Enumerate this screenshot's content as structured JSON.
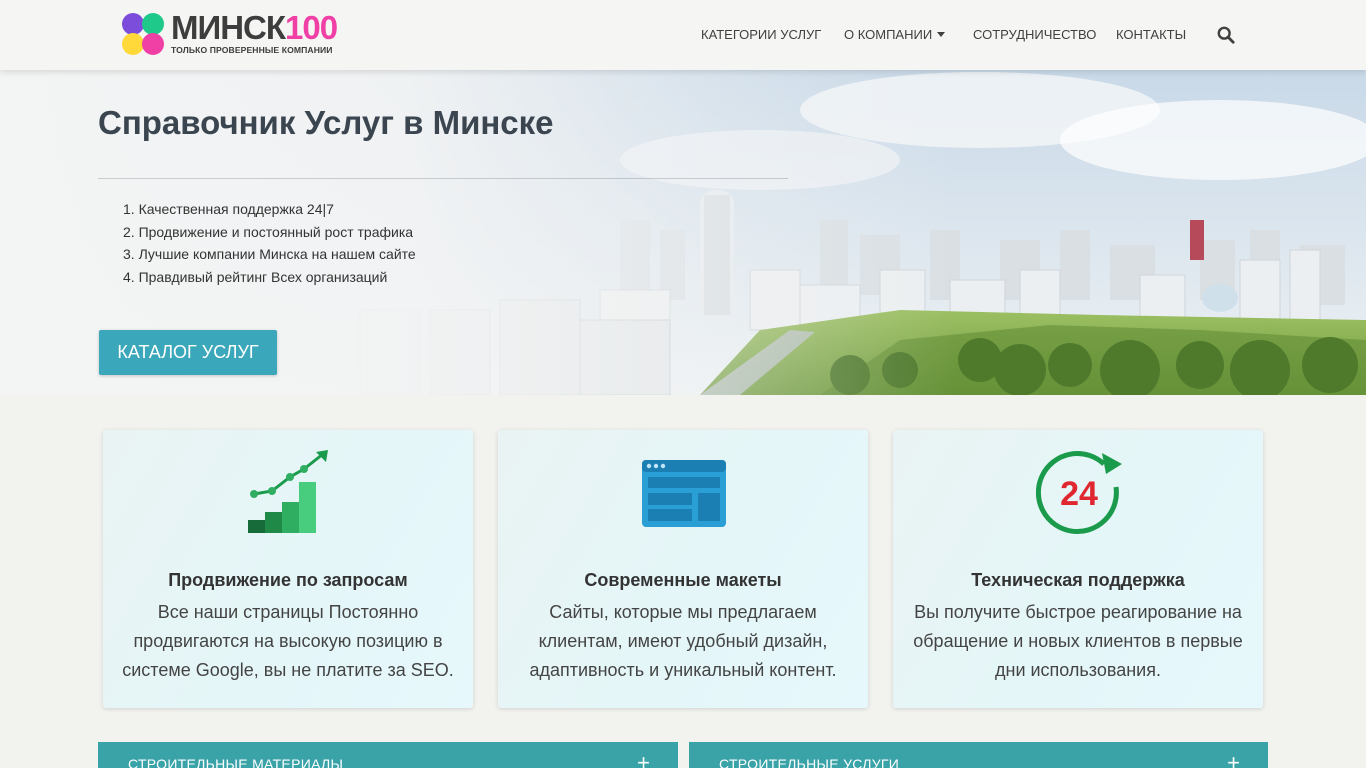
{
  "header": {
    "logo": {
      "name_text": "МИНСК",
      "name_number": "100",
      "tagline": "ТОЛЬКО ПРОВЕРЕННЫЕ КОМПАНИИ"
    },
    "nav": [
      {
        "label": "КАТЕГОРИИ УСЛУГ",
        "has_dropdown": false
      },
      {
        "label": "О КОМПАНИИ",
        "has_dropdown": true
      },
      {
        "label": "СОТРУДНИЧЕСТВО",
        "has_dropdown": false
      },
      {
        "label": "КОНТАКТЫ",
        "has_dropdown": false
      }
    ],
    "search_icon": "search-icon"
  },
  "hero": {
    "title": "Справочник Услуг в Минске",
    "list": [
      "Качественная поддержка 24|7",
      "Продвижение и постоянный рост трафика",
      "Лучшие компании Минска на нашем сайте",
      "Правдивый рейтинг Всех организаций"
    ],
    "button_label": "КАТАЛОГ УСЛУГ"
  },
  "features": [
    {
      "icon": "growth-chart-icon",
      "title": "Продвижение по запросам",
      "text": "Все наши страницы Постоянно продвигаются на высокую позицию в системе Google, вы не платите за SEO."
    },
    {
      "icon": "layout-template-icon",
      "title": "Современные макеты",
      "text": "Сайты, которые мы предлагаем клиентам, имеют удобный дизайн, адаптивность и уникальный контент."
    },
    {
      "icon": "support-24-icon",
      "icon_text": "24",
      "title": "Техническая поддержка",
      "text": "Вы получите быстрое реагирование на обращение и новых клиентов в первые дни использования."
    }
  ],
  "categories": [
    {
      "label": "СТРОИТЕЛЬНЫЕ МАТЕРИАЛЫ",
      "toggle": "+"
    },
    {
      "label": "СТРОИТЕЛЬНЫЕ УСЛУГИ",
      "toggle": "+"
    }
  ],
  "colors": {
    "accent": "#3ba7ba",
    "category_bar": "#3aa3a8",
    "logo_pink": "#f03fa5",
    "logo_purple": "#7c4ddb",
    "logo_green": "#1fc98a",
    "logo_yellow": "#ffd93a",
    "support_red": "#e0262f",
    "support_green": "#1a9a4b"
  }
}
